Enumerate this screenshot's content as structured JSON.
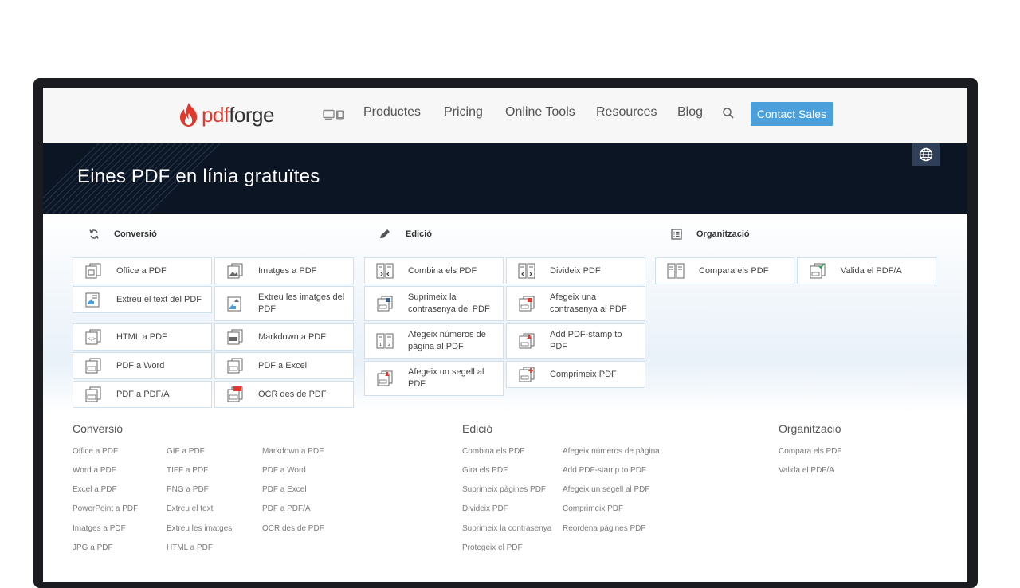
{
  "header": {
    "logo_pdf": "pdf",
    "logo_forge": "forge",
    "nav": [
      "Productes",
      "Pricing",
      "Online Tools",
      "Resources",
      "Blog"
    ],
    "contact_label": "Contact Sales"
  },
  "hero": {
    "title": "Eines PDF en línia gratuïtes"
  },
  "sections": [
    {
      "title": "Conversió",
      "icon": "refresh-icon"
    },
    {
      "title": "Edició",
      "icon": "pencil-icon"
    },
    {
      "title": "Organització",
      "icon": "list-icon"
    }
  ],
  "tools": {
    "conversio": [
      "Office a PDF",
      "Imatges a PDF",
      "Extreu el text del PDF",
      "Extreu les imatges del PDF",
      "HTML a PDF",
      "Markdown a PDF",
      "PDF a Word",
      "PDF a Excel",
      "PDF a PDF/A",
      "OCR des de PDF"
    ],
    "edicio": [
      "Combina els PDF",
      "Divideix PDF",
      "Suprimeix la contrasenya del PDF",
      "Afegeix una contrasenya al PDF",
      "Afegeix números de pàgina al PDF",
      "Add PDF-stamp to PDF",
      "Afegeix un segell al PDF",
      "Comprimeix PDF"
    ],
    "organitzacio": [
      "Compara els PDF",
      "Valida el PDF/A"
    ]
  },
  "footer": {
    "conversio_title": "Conversió",
    "conversio_col1": [
      "Office a PDF",
      "Word a PDF",
      "Excel a PDF",
      "PowerPoint a PDF",
      "Imatges a PDF",
      "JPG a PDF"
    ],
    "conversio_col2": [
      "GIF a PDF",
      "TIFF a PDF",
      "PNG a PDF",
      "Extreu el text",
      "Extreu les imatges",
      "HTML a PDF"
    ],
    "conversio_col3": [
      "Markdown a PDF",
      "PDF a Word",
      "PDF a Excel",
      "PDF a PDF/A",
      "OCR des de PDF"
    ],
    "edicio_title": "Edició",
    "edicio_col1": [
      "Combina els PDF",
      "Gira els PDF",
      "Suprimeix pàgines PDF",
      "Divideix PDF",
      "Suprimeix la contrasenya",
      "Protegeix el PDF"
    ],
    "edicio_col2": [
      "Afegeix números de pàgina",
      "Add PDF-stamp to PDF",
      "Afegeix un segell al PDF",
      "Comprimeix PDF",
      "Reordena pàgines PDF"
    ],
    "organitzacio_title": "Organització",
    "organitzacio_col1": [
      "Compara els PDF",
      "Valida el PDF/A"
    ]
  },
  "colors": {
    "accent": "#4ba0db",
    "brand": "#e03a2f",
    "hero_bg": "#0c1524",
    "card_border": "#cfe0ee"
  }
}
